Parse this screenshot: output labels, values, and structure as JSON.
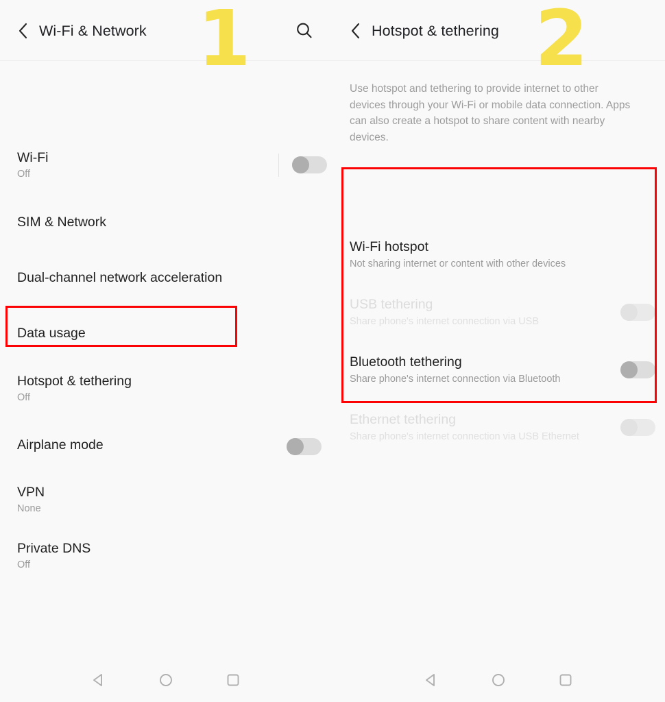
{
  "left_panel": {
    "appbar": {
      "back_icon": "chevron-left-icon",
      "title": "Wi-Fi & Network",
      "search_icon": "search-icon"
    },
    "step_number": "1",
    "rows": [
      {
        "title": "Wi-Fi",
        "subtitle": "Off",
        "toggle": "off",
        "enabled": true
      },
      {
        "title": "SIM & Network",
        "subtitle": "",
        "toggle": null,
        "enabled": true
      },
      {
        "title": "Dual-channel network acceleration",
        "subtitle": "",
        "toggle": null,
        "enabled": true
      },
      {
        "title": "Data usage",
        "subtitle": "",
        "toggle": null,
        "enabled": true
      },
      {
        "title": "Hotspot & tethering",
        "subtitle": "Off",
        "toggle": null,
        "enabled": true
      },
      {
        "title": "Airplane mode",
        "subtitle": "",
        "toggle": "off",
        "enabled": true
      },
      {
        "title": "VPN",
        "subtitle": "None",
        "toggle": null,
        "enabled": true
      },
      {
        "title": "Private DNS",
        "subtitle": "Off",
        "toggle": null,
        "enabled": true
      }
    ]
  },
  "right_panel": {
    "appbar": {
      "back_icon": "chevron-left-icon",
      "title": "Hotspot & tethering",
      "search_icon": "search-icon"
    },
    "step_number": "2",
    "description": "Use hotspot and tethering to provide internet to other devices through your Wi-Fi or mobile data connection. Apps can also create a hotspot to share content with nearby devices.",
    "rows": [
      {
        "title": "Wi-Fi hotspot",
        "subtitle": "Not sharing internet or content with other devices",
        "toggle": null,
        "enabled": true
      },
      {
        "title": "USB tethering",
        "subtitle": "Share phone's internet connection via USB",
        "toggle": "off",
        "enabled": false
      },
      {
        "title": "Bluetooth tethering",
        "subtitle": "Share phone's internet connection via Bluetooth",
        "toggle": "off",
        "enabled": true
      },
      {
        "title": "Ethernet tethering",
        "subtitle": "Share phone's internet connection via USB Ethernet",
        "toggle": "off",
        "enabled": false
      }
    ]
  },
  "navbar": {
    "back_icon": "nav-back-triangle-icon",
    "home_icon": "nav-home-circle-icon",
    "recents_icon": "nav-recents-square-icon"
  },
  "annotations": {
    "highlight_color": "#fb0304",
    "step_color": "#f6e04b",
    "left_highlight_target": "Hotspot & tethering",
    "right_highlight_target": "tethering options group"
  }
}
